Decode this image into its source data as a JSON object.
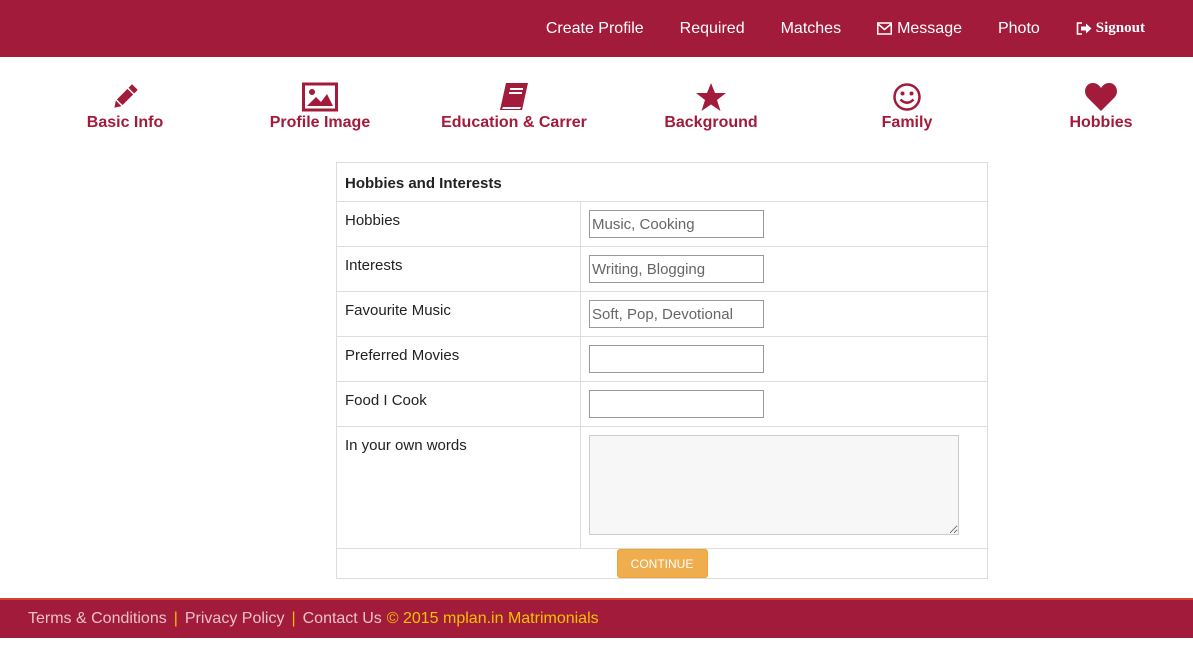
{
  "nav": {
    "create_profile": "Create Profile",
    "required": "Required",
    "matches": "Matches",
    "message": "Message",
    "photo": "Photo",
    "signout": "Signout"
  },
  "steps": [
    {
      "label": "Basic Info",
      "icon": "pencil-icon"
    },
    {
      "label": "Profile Image",
      "icon": "picture-icon"
    },
    {
      "label": "Education & Carrer",
      "icon": "book-icon"
    },
    {
      "label": "Background",
      "icon": "star-icon"
    },
    {
      "label": "Family",
      "icon": "smile-icon"
    },
    {
      "label": "Hobbies",
      "icon": "heart-icon"
    }
  ],
  "form": {
    "heading": "Hobbies and Interests",
    "fields": [
      {
        "label": "Hobbies",
        "placeholder": "Music, Cooking",
        "value": ""
      },
      {
        "label": "Interests",
        "placeholder": "Writing, Blogging",
        "value": ""
      },
      {
        "label": "Favourite Music",
        "placeholder": "Soft, Pop, Devotional",
        "value": ""
      },
      {
        "label": "Preferred Movies",
        "placeholder": "",
        "value": ""
      },
      {
        "label": "Food I Cook",
        "placeholder": "",
        "value": ""
      }
    ],
    "own_words_label": "In your own words",
    "continue_label": "CONTINUE"
  },
  "footer": {
    "terms": "Terms & Conditions",
    "privacy": "Privacy Policy",
    "contact": "Contact Us",
    "separator": "|",
    "copyright": "© 2015 mplan.in Matrimonials"
  },
  "colors": {
    "brand": "#a31b3a",
    "accent_button": "#f0ad4e",
    "footer_highlight": "#f2c200"
  }
}
